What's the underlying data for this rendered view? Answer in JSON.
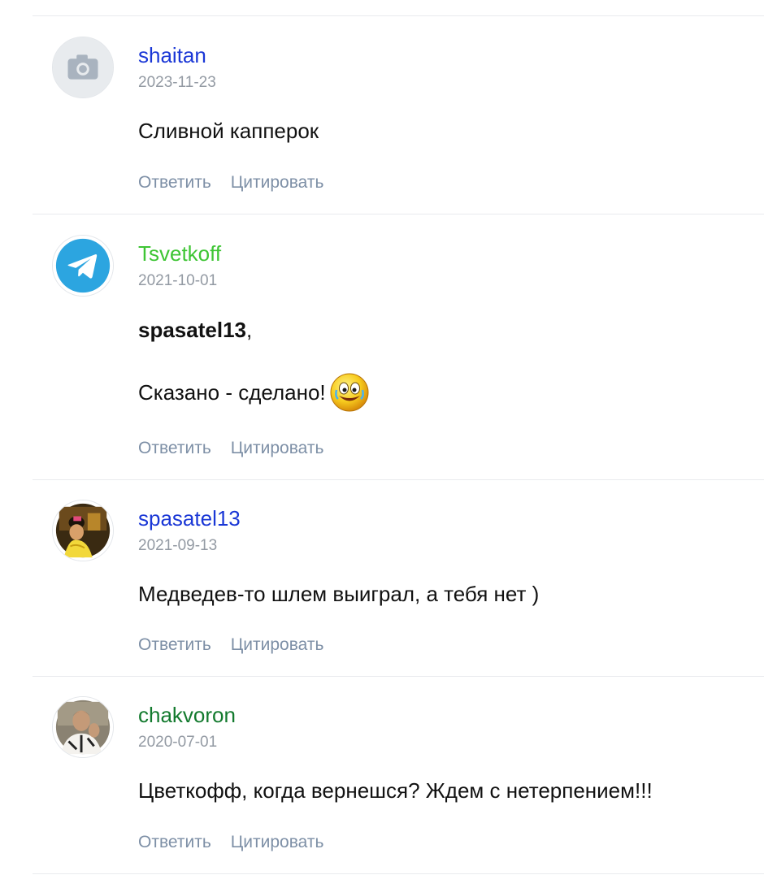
{
  "comments": [
    {
      "author": "shaitan",
      "author_color": "#1a37d6",
      "avatar_icon": "camera-placeholder-icon",
      "date": "2023-11-23",
      "text": "Сливной капперок",
      "reply_label": "Ответить",
      "quote_label": "Цитировать"
    },
    {
      "author": "Tsvetkoff",
      "author_color": "#3ec534",
      "avatar_icon": "telegram-icon",
      "date": "2021-10-01",
      "mention": "spasatel13",
      "mention_suffix": ",",
      "text": "Сказано - сделано!",
      "emoji_icon": "laughing-smiley-icon",
      "reply_label": "Ответить",
      "quote_label": "Цитировать"
    },
    {
      "author": "spasatel13",
      "author_color": "#1a37d6",
      "avatar_icon": "user-photo-avatar",
      "date": "2021-09-13",
      "text": "Медведев-то шлем выиграл, а тебя нет )",
      "reply_label": "Ответить",
      "quote_label": "Цитировать"
    },
    {
      "author": "chakvoron",
      "author_color": "#137a2e",
      "avatar_icon": "user-photo-avatar",
      "date": "2020-07-01",
      "text": "Цветкофф, когда вернешся? Ждем с нетерпением!!!",
      "reply_label": "Ответить",
      "quote_label": "Цитировать"
    }
  ]
}
